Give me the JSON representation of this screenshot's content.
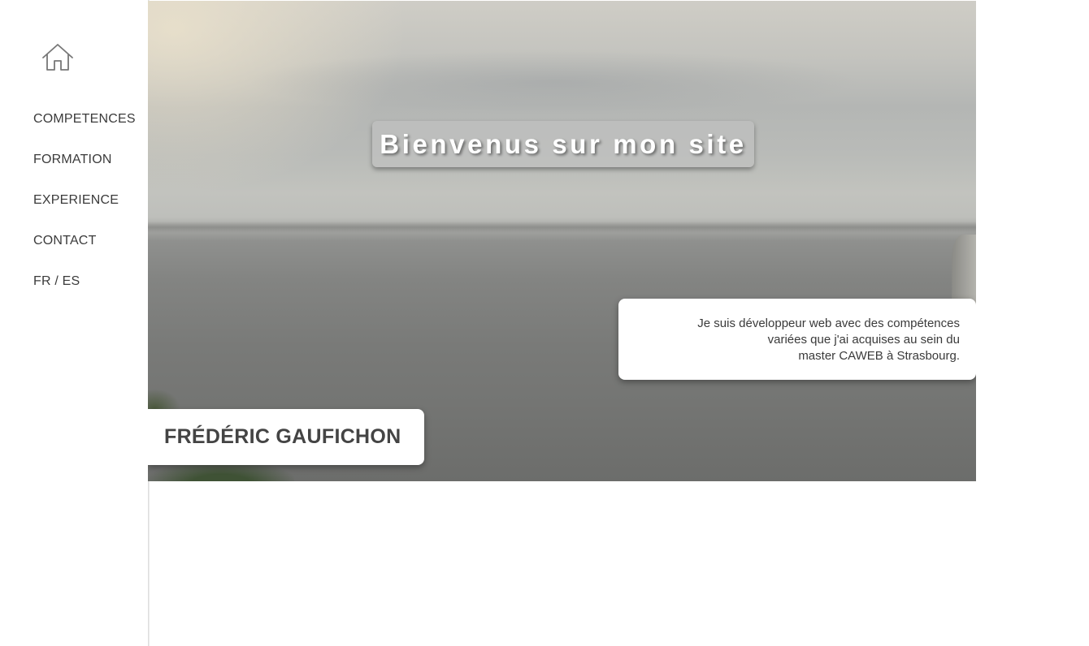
{
  "sidebar": {
    "home_icon": "home-icon",
    "items": [
      {
        "label": "COMPETENCES"
      },
      {
        "label": "FORMATION"
      },
      {
        "label": "EXPERIENCE"
      },
      {
        "label": "CONTACT"
      },
      {
        "label": "FR / ES"
      }
    ]
  },
  "hero": {
    "welcome": "Bienvenus sur mon site",
    "intro_lines": [
      "Je suis développeur web avec des compétences",
      "variées que j'ai acquises au sein du",
      "master CAWEB à Strasbourg."
    ],
    "name": "FRÉDÉRIC GAUFICHON"
  },
  "colors": {
    "text": "#3a3a3a",
    "card_bg": "#ffffff",
    "title_text": "#ffffff"
  }
}
